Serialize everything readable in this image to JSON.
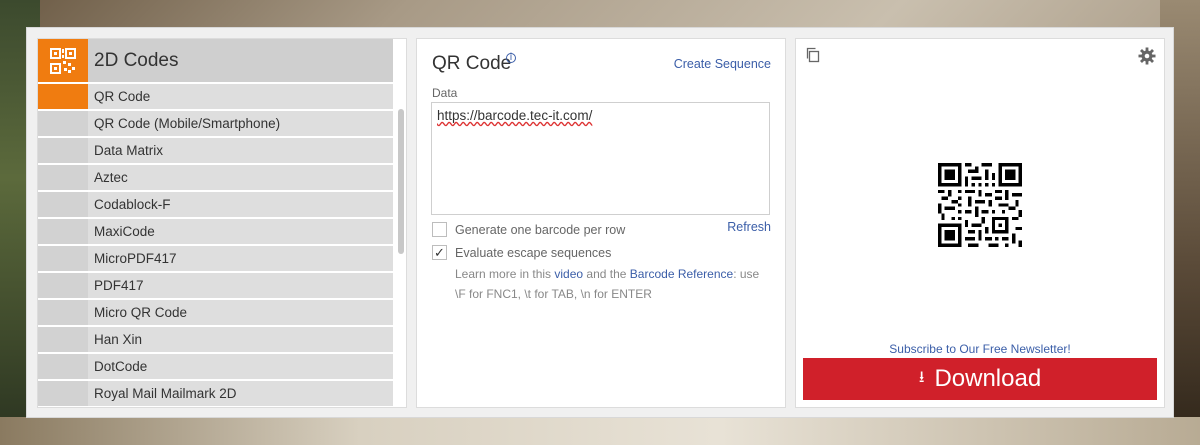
{
  "category": {
    "title": "2D Codes",
    "items": [
      {
        "label": "QR Code",
        "active": true
      },
      {
        "label": "QR Code (Mobile/Smartphone)",
        "active": false
      },
      {
        "label": "Data Matrix",
        "active": false
      },
      {
        "label": "Aztec",
        "active": false
      },
      {
        "label": "Codablock-F",
        "active": false
      },
      {
        "label": "MaxiCode",
        "active": false
      },
      {
        "label": "MicroPDF417",
        "active": false
      },
      {
        "label": "PDF417",
        "active": false
      },
      {
        "label": "Micro QR Code",
        "active": false
      },
      {
        "label": "Han Xin",
        "active": false
      },
      {
        "label": "DotCode",
        "active": false
      },
      {
        "label": "Royal Mail Mailmark 2D",
        "active": false
      }
    ]
  },
  "editor": {
    "title": "QR Code",
    "info_glyph": "i",
    "create_sequence": "Create Sequence",
    "data_label": "Data",
    "data_value": "https://barcode.tec-it.com/",
    "refresh": "Refresh",
    "option_per_row": {
      "label": "Generate one barcode per row",
      "checked": false
    },
    "option_escape": {
      "label": "Evaluate escape sequences",
      "checked": true
    },
    "help": {
      "prefix": "Learn more in this ",
      "video_link": "video",
      "middle": " and the ",
      "reference_link": "Barcode Reference",
      "suffix": ": use \\F for FNC1, \\t for TAB, \\n for ENTER"
    }
  },
  "preview": {
    "newsletter": "Subscribe to Our Free Newsletter!",
    "download_label": "Download"
  },
  "colors": {
    "accent": "#f07c10",
    "link": "#3b5ea8",
    "download": "#d0202a"
  },
  "icons": [
    "qr-code-icon",
    "info-icon",
    "checkmark-icon",
    "copy-icon",
    "gear-icon",
    "download-icon"
  ]
}
